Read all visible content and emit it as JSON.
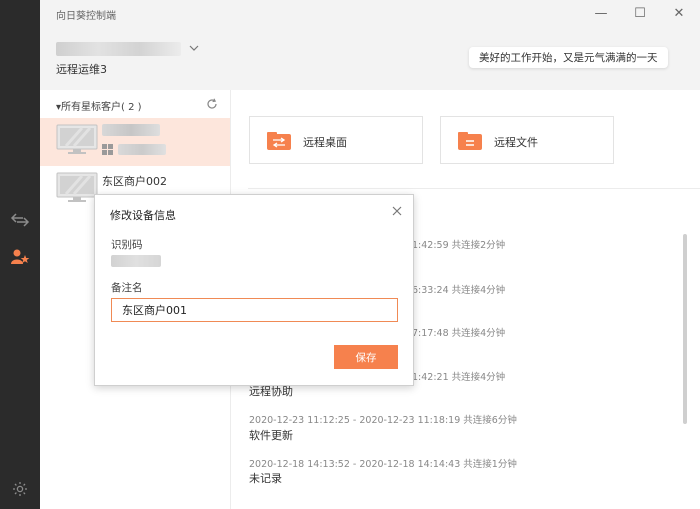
{
  "app": {
    "title": "向日葵控制端"
  },
  "window_controls": {
    "minimize": "—",
    "maximize": "☐",
    "close": "✕"
  },
  "account": {
    "name": "远程运维3",
    "greeting": "美好的工作开始，又是元气满满的一天"
  },
  "sidebar": {
    "group_header": "▾所有星标客户( 2 )",
    "devices": [
      {
        "name": "",
        "selected": true
      },
      {
        "name": "东区商户002",
        "selected": false
      }
    ]
  },
  "actions": {
    "remote_desktop": "远程桌面",
    "remote_files": "远程文件"
  },
  "records": [
    {
      "time": "1:42:59 共连接2分钟",
      "type": ""
    },
    {
      "time": "6:33:24 共连接4分钟",
      "type": ""
    },
    {
      "time": "7:17:48 共连接4分钟",
      "type": ""
    },
    {
      "time": "1:42:21 共连接4分钟",
      "type": "远程协助"
    },
    {
      "time": "2020-12-23 11:12:25 - 2020-12-23 11:18:19 共连接6分钟",
      "type": "软件更新"
    },
    {
      "time": "2020-12-18 14:13:52 - 2020-12-18 14:14:43 共连接1分钟",
      "type": "未记录"
    }
  ],
  "dialog": {
    "title": "修改设备信息",
    "id_label": "识别码",
    "remark_label": "备注名",
    "remark_value": "东区商户001",
    "save_label": "保存"
  },
  "colors": {
    "accent": "#f6814d",
    "rail": "#2b2b2b",
    "selected_row": "#fde6dc"
  }
}
